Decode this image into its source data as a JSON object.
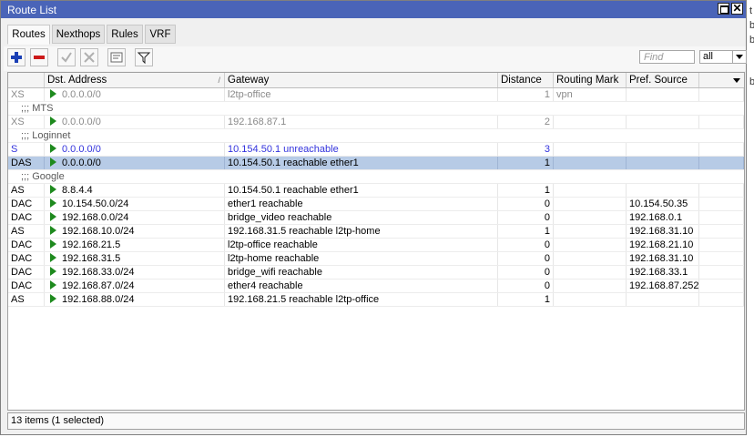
{
  "window": {
    "title": "Route List"
  },
  "tabs": [
    {
      "label": "Routes",
      "active": true
    },
    {
      "label": "Nexthops",
      "active": false
    },
    {
      "label": "Rules",
      "active": false
    },
    {
      "label": "VRF",
      "active": false
    }
  ],
  "toolbar": {
    "icons": [
      "add-icon",
      "remove-icon",
      "enable-icon",
      "disable-icon",
      "comment-icon",
      "filter-icon"
    ],
    "find_placeholder": "Find",
    "scope_selected": "all"
  },
  "columns": [
    "",
    "Dst. Address",
    "Gateway",
    "Distance",
    "Routing Mark",
    "Pref. Source"
  ],
  "rows": [
    {
      "type": "route",
      "style": "gray",
      "flags": "XS",
      "dst": "0.0.0.0/0",
      "gateway": "l2tp-office",
      "distance": "1",
      "mark": "vpn",
      "pref": ""
    },
    {
      "type": "comment",
      "text": ";;; MTS"
    },
    {
      "type": "route",
      "style": "gray",
      "flags": "XS",
      "dst": "0.0.0.0/0",
      "gateway": "192.168.87.1",
      "distance": "2",
      "mark": "",
      "pref": ""
    },
    {
      "type": "comment",
      "text": ";;; Loginnet"
    },
    {
      "type": "route",
      "style": "blue",
      "flags": "S",
      "dst": "0.0.0.0/0",
      "gateway": "10.154.50.1 unreachable",
      "distance": "3",
      "mark": "",
      "pref": ""
    },
    {
      "type": "route",
      "style": "sel",
      "flags": "DAS",
      "dst": "0.0.0.0/0",
      "gateway": "10.154.50.1 reachable ether1",
      "distance": "1",
      "mark": "",
      "pref": ""
    },
    {
      "type": "comment",
      "text": ";;; Google"
    },
    {
      "type": "route",
      "style": "normal",
      "flags": "AS",
      "dst": "8.8.4.4",
      "gateway": "10.154.50.1 reachable ether1",
      "distance": "1",
      "mark": "",
      "pref": ""
    },
    {
      "type": "route",
      "style": "normal",
      "flags": "DAC",
      "dst": "10.154.50.0/24",
      "gateway": "ether1 reachable",
      "distance": "0",
      "mark": "",
      "pref": "10.154.50.35"
    },
    {
      "type": "route",
      "style": "normal",
      "flags": "DAC",
      "dst": "192.168.0.0/24",
      "gateway": "bridge_video reachable",
      "distance": "0",
      "mark": "",
      "pref": "192.168.0.1"
    },
    {
      "type": "route",
      "style": "normal",
      "flags": "AS",
      "dst": "192.168.10.0/24",
      "gateway": "192.168.31.5 reachable l2tp-home",
      "distance": "1",
      "mark": "",
      "pref": "192.168.31.10"
    },
    {
      "type": "route",
      "style": "normal",
      "flags": "DAC",
      "dst": "192.168.21.5",
      "gateway": "l2tp-office reachable",
      "distance": "0",
      "mark": "",
      "pref": "192.168.21.10"
    },
    {
      "type": "route",
      "style": "normal",
      "flags": "DAC",
      "dst": "192.168.31.5",
      "gateway": "l2tp-home reachable",
      "distance": "0",
      "mark": "",
      "pref": "192.168.31.10"
    },
    {
      "type": "route",
      "style": "normal",
      "flags": "DAC",
      "dst": "192.168.33.0/24",
      "gateway": "bridge_wifi reachable",
      "distance": "0",
      "mark": "",
      "pref": "192.168.33.1"
    },
    {
      "type": "route",
      "style": "normal",
      "flags": "DAC",
      "dst": "192.168.87.0/24",
      "gateway": "ether4 reachable",
      "distance": "0",
      "mark": "",
      "pref": "192.168.87.252"
    },
    {
      "type": "route",
      "style": "normal",
      "flags": "AS",
      "dst": "192.168.88.0/24",
      "gateway": "192.168.21.5 reachable l2tp-office",
      "distance": "1",
      "mark": "",
      "pref": ""
    }
  ],
  "status": {
    "text": "13 items (1 selected)"
  },
  "background_chars": [
    "t",
    "b",
    "b",
    "b"
  ]
}
